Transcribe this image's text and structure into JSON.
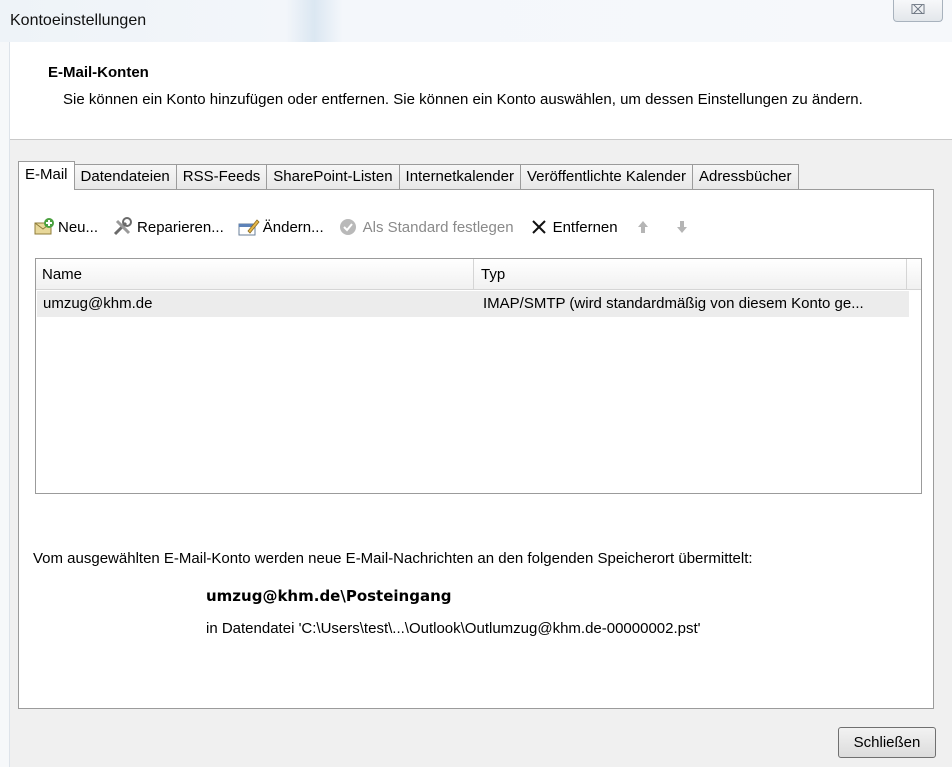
{
  "window": {
    "title": "Kontoeinstellungen",
    "close_glyph": "⌧"
  },
  "header": {
    "heading": "E-Mail-Konten",
    "description": "Sie können ein Konto hinzufügen oder entfernen. Sie können ein Konto auswählen, um dessen Einstellungen zu ändern."
  },
  "tabs": [
    {
      "label": "E-Mail",
      "active": true
    },
    {
      "label": "Datendateien"
    },
    {
      "label": "RSS-Feeds"
    },
    {
      "label": "SharePoint-Listen"
    },
    {
      "label": "Internetkalender"
    },
    {
      "label": "Veröffentlichte Kalender"
    },
    {
      "label": "Adressbücher"
    }
  ],
  "toolbar": {
    "new_label": "Neu...",
    "repair_label": "Reparieren...",
    "change_label": "Ändern...",
    "default_label": "Als Standard festlegen",
    "remove_label": "Entfernen",
    "icons": [
      "new-account-icon",
      "repair-icon",
      "change-icon",
      "check-icon",
      "x-icon",
      "arrow-up-icon",
      "arrow-down-icon"
    ]
  },
  "accounts": {
    "columns": [
      "Name",
      "Typ"
    ],
    "rows": [
      {
        "name": "umzug@khm.de",
        "type": "IMAP/SMTP (wird standardmäßig von diesem Konto ge..."
      }
    ]
  },
  "delivery": {
    "info": "Vom ausgewählten E-Mail-Konto werden neue E-Mail-Nachrichten an den folgenden Speicherort übermittelt:",
    "location": "umzug@khm.de\\Posteingang",
    "file": "in Datendatei 'C:\\Users\\test\\...\\Outlook\\Outlumzug@khm.de-00000002.pst'"
  },
  "footer": {
    "close_label": "Schließen"
  },
  "colors": {
    "disabled_text": "#8a8a8a",
    "selected_row": "#ececec",
    "panel_border": "#9b9b9b"
  }
}
